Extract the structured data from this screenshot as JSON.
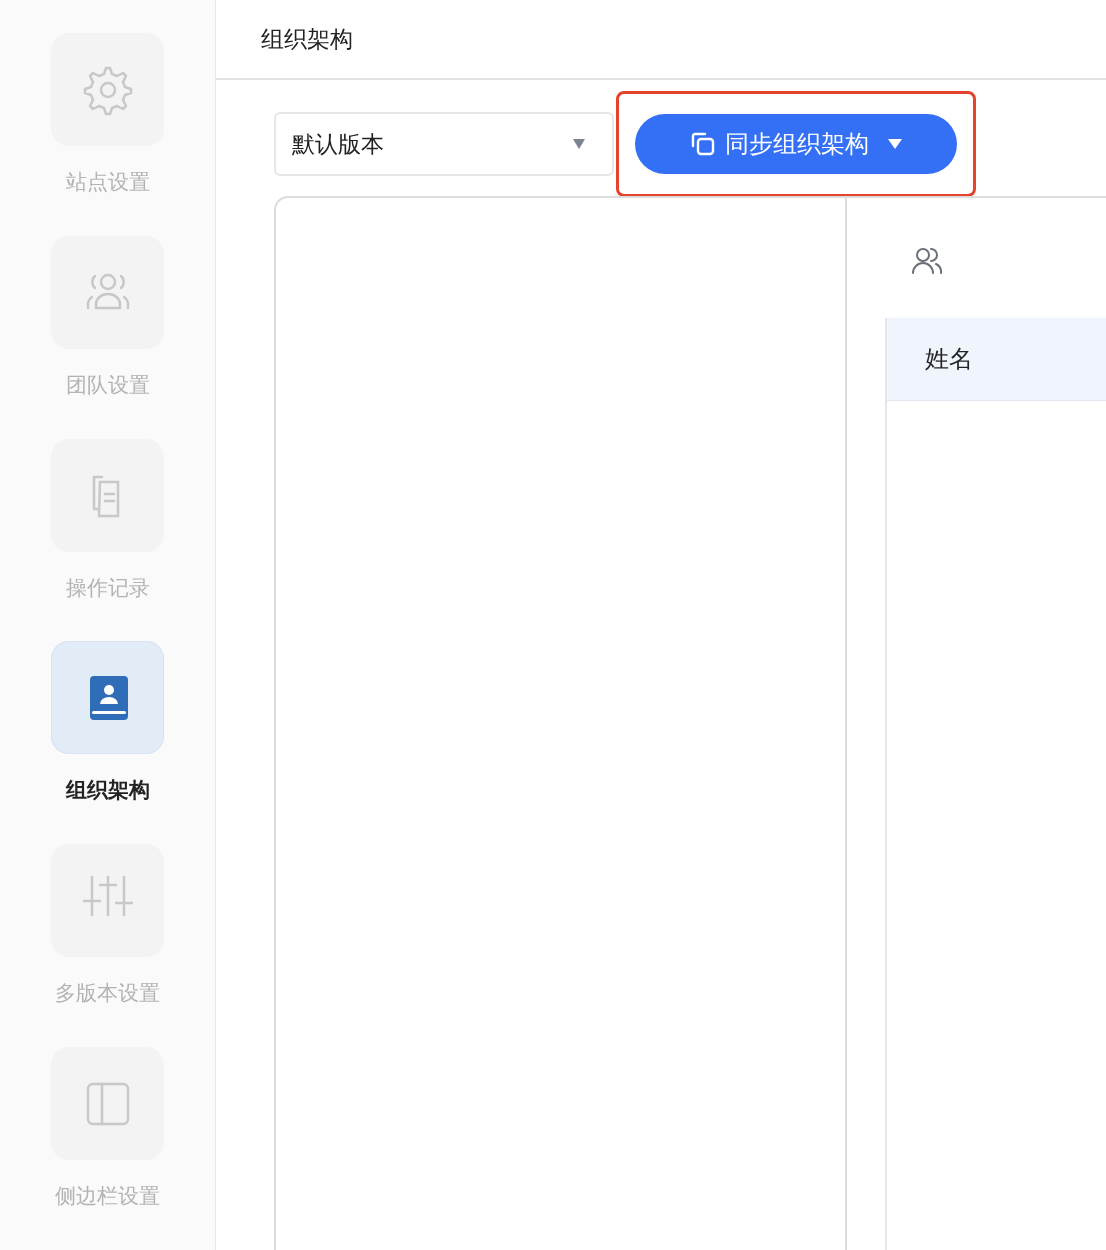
{
  "sidebar": {
    "items": [
      {
        "label": "站点设置",
        "selected": false
      },
      {
        "label": "团队设置",
        "selected": false
      },
      {
        "label": "操作记录",
        "selected": false
      },
      {
        "label": "组织架构",
        "selected": true
      },
      {
        "label": "多版本设置",
        "selected": false
      },
      {
        "label": "侧边栏设置",
        "selected": false
      }
    ]
  },
  "header": {
    "title": "组织架构"
  },
  "toolbar": {
    "version_select": {
      "value": "默认版本"
    },
    "sync_button": {
      "label": "同步组织架构",
      "highlighted": true
    }
  },
  "members_table": {
    "columns": [
      "姓名"
    ]
  }
}
